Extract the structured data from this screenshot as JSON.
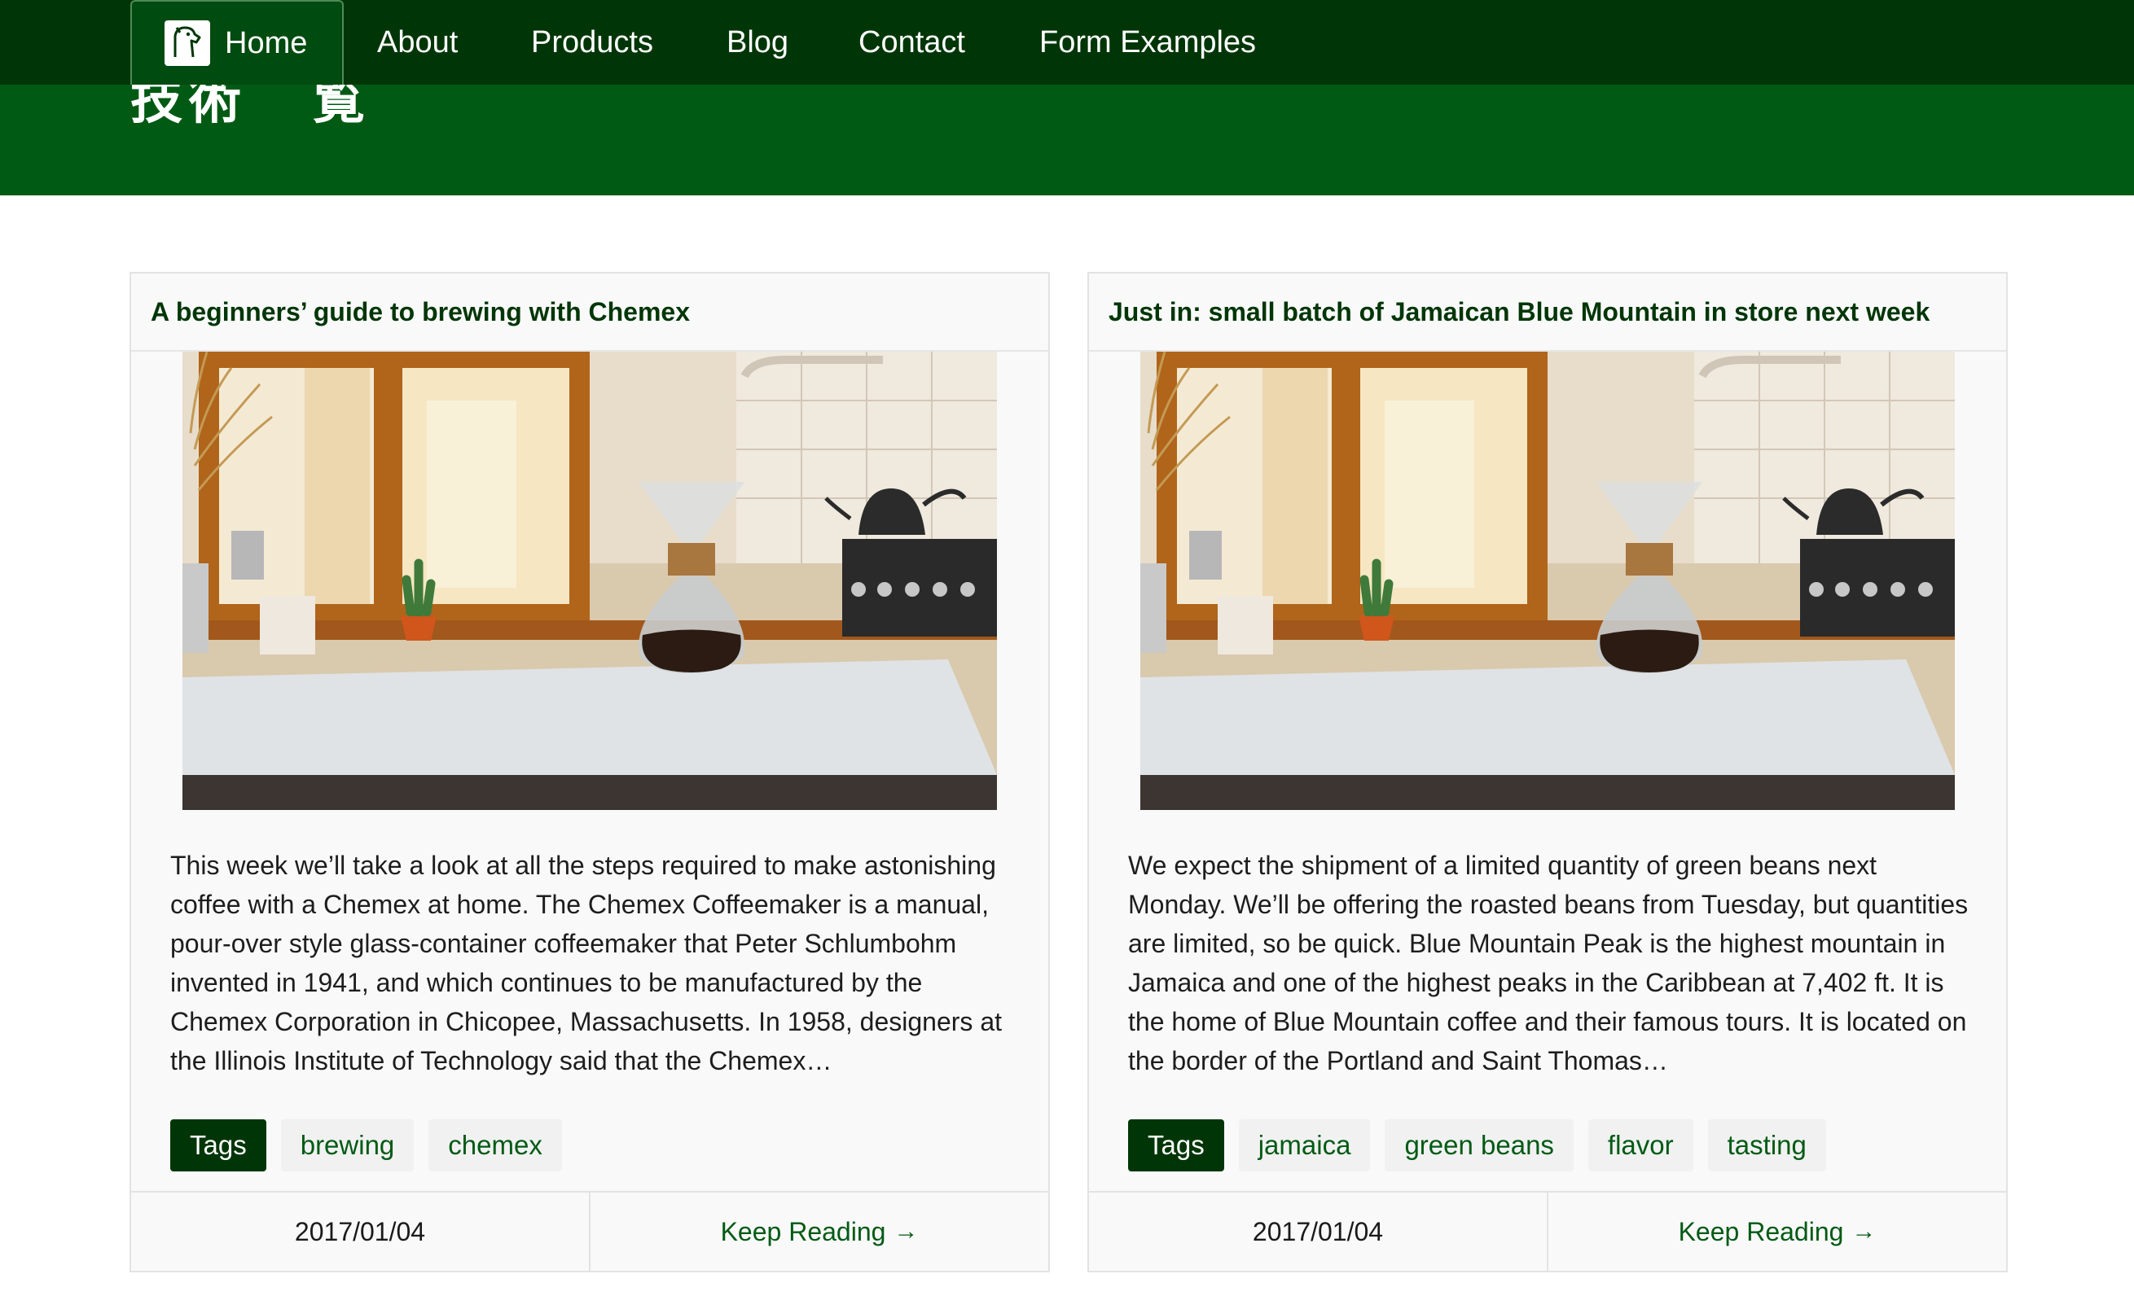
{
  "nav": {
    "items": [
      {
        "label": "Home"
      },
      {
        "label": "About"
      },
      {
        "label": "Products"
      },
      {
        "label": "Blog"
      },
      {
        "label": "Contact"
      },
      {
        "label": "Form Examples"
      }
    ]
  },
  "hero": {
    "title_part1": "技術",
    "title_part2": "覧"
  },
  "posts": [
    {
      "title": "A beginners’ guide to brewing with Chemex",
      "excerpt": "This week we’ll take a look at all the steps required to make astonishing coffee with a Chemex at home. The Chemex Coffeemaker is a manual, pour-over style glass-container coffeemaker that Peter Schlumbohm invented in 1941, and which continues to be manufactured by the Chemex Corporation in Chicopee, Massachusetts. In 1958, designers at the Illinois Institute of Technology said that the Chemex…",
      "tags_label": "Tags",
      "tags": [
        "brewing",
        "chemex"
      ],
      "date": "2017/01/04",
      "keep_reading": "Keep Reading"
    },
    {
      "title": "Just in: small batch of Jamaican Blue Mountain in store next week",
      "excerpt": "We expect the shipment of a limited quantity of green beans next Monday. We’ll be offering the roasted beans from Tuesday, but quantities are limited, so be quick. Blue Mountain Peak is the highest mountain in Jamaica and one of the highest peaks in the Caribbean at 7,402 ft. It is the home of Blue Mountain coffee and their famous tours. It is located on the border of the Portland and Saint Thomas…",
      "tags_label": "Tags",
      "tags": [
        "jamaica",
        "green beans",
        "flavor",
        "tasting"
      ],
      "date": "2017/01/04",
      "keep_reading": "Keep Reading"
    }
  ],
  "colors": {
    "nav_bg": "#003607",
    "hero_bg": "#005a14",
    "accent": "#005a14"
  }
}
